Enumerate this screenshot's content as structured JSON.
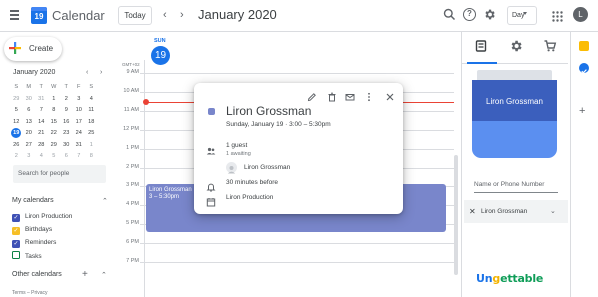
{
  "header": {
    "app_title": "Calendar",
    "logo_day": "19",
    "today_label": "Today",
    "month_title": "January 2020",
    "view_label": "Day",
    "avatar_letter": "L"
  },
  "sidebar": {
    "create_label": "Create",
    "mini_calendar": {
      "month_label": "January 2020",
      "weekdays": [
        "S",
        "M",
        "T",
        "W",
        "T",
        "F",
        "S"
      ],
      "weeks": [
        [
          "29",
          "30",
          "31",
          "1",
          "2",
          "3",
          "4"
        ],
        [
          "5",
          "6",
          "7",
          "8",
          "9",
          "10",
          "11"
        ],
        [
          "12",
          "13",
          "14",
          "15",
          "16",
          "17",
          "18"
        ],
        [
          "19",
          "20",
          "21",
          "22",
          "23",
          "24",
          "25"
        ],
        [
          "26",
          "27",
          "28",
          "29",
          "30",
          "31",
          "1"
        ],
        [
          "2",
          "3",
          "4",
          "5",
          "6",
          "7",
          "8"
        ]
      ],
      "selected": "19"
    },
    "search_placeholder": "Search for people",
    "my_calendars_label": "My calendars",
    "calendars": [
      {
        "name": "Liron Production",
        "color": "#3f51b5",
        "checked": true
      },
      {
        "name": "Birthdays",
        "color": "#f6bf26",
        "checked": true
      },
      {
        "name": "Reminders",
        "color": "#3f51b5",
        "checked": true
      },
      {
        "name": "Tasks",
        "color": "#0b8043",
        "checked": false
      }
    ],
    "other_calendars_label": "Other calendars",
    "terms_label": "Terms – Privacy"
  },
  "day_view": {
    "weekday": "SUN",
    "day_number": "19",
    "timezone": "GMT+02",
    "hours": [
      "9 AM",
      "10 AM",
      "11 AM",
      "12 PM",
      "1 PM",
      "2 PM",
      "3 PM",
      "4 PM",
      "5 PM",
      "6 PM",
      "7 PM"
    ],
    "event": {
      "title": "Liron Grossman",
      "time": "3 – 5:30pm",
      "color": "#7986cb"
    }
  },
  "popup": {
    "title": "Liron Grossman",
    "date_time": "Sunday, January 19  ·  3:00 – 5:30pm",
    "guests_count": "1 guest",
    "guests_status": "1 awaiting",
    "guest_name": "Liron Grossman",
    "reminder": "30 minutes before",
    "calendar_name": "Liron Production",
    "color": "#7986cb"
  },
  "side_panel": {
    "card_name": "Liron Grossman",
    "phone_placeholder": "Name or Phone Number",
    "contact_name": "Liron Grossman",
    "brand": {
      "part1": "Un",
      "part2": "g",
      "part3": "ettable"
    }
  },
  "colors": {
    "accent": "#1a73e8",
    "now_line": "#ea4335",
    "event": "#7986cb"
  }
}
